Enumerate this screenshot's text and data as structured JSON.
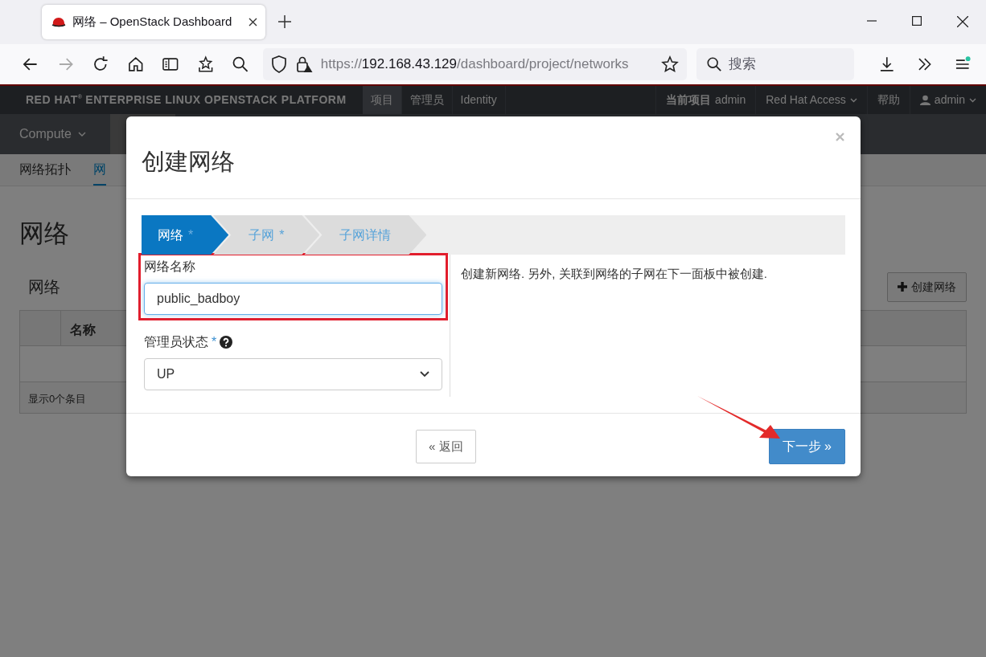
{
  "browser": {
    "tab_title": "网络 – OpenStack Dashboard",
    "url_scheme": "https://",
    "url_host": "192.168.43.129",
    "url_path": "/dashboard/project/networks",
    "search_placeholder": "搜索"
  },
  "topbar": {
    "brand": "RED HAT$^{®}$ ENTERPRISE LINUX OPENSTACK PLATFORM",
    "nav": [
      {
        "label": "项目",
        "selected": true
      },
      {
        "label": "管理员",
        "selected": false
      },
      {
        "label": "Identity",
        "selected": false
      }
    ],
    "project_label": "当前项目",
    "project": "admin",
    "access": "Red Hat Access",
    "help": "帮助",
    "user": "admin"
  },
  "section_nav": {
    "label": "Compute"
  },
  "tabs": [
    {
      "label": "网络拓扑",
      "selected": false
    },
    {
      "label": "网",
      "selected": true
    }
  ],
  "page": {
    "title": "网络",
    "panel_title": "网络",
    "create_button": "创建网络",
    "columns": [
      "名称"
    ],
    "footer": "显示0个条目"
  },
  "modal": {
    "title": "创建网络",
    "steps": [
      {
        "label": "网络",
        "mark": "*",
        "selected": true
      },
      {
        "label": "子网",
        "mark": "*",
        "selected": false
      },
      {
        "label": "子网详情",
        "selected": false
      }
    ],
    "fields": [
      {
        "kind": "text",
        "label": "网络名称",
        "value": "public_badboy",
        "highlighted": true
      },
      {
        "kind": "select",
        "label": "管理员状态",
        "mark": "*",
        "value": "UP",
        "highlighted": false
      }
    ],
    "help_text": "创建新网络. 另外, 关联到网络的子网在下一面板中被创建.",
    "back_button": "« 返回",
    "next_button": "下一步 »"
  }
}
